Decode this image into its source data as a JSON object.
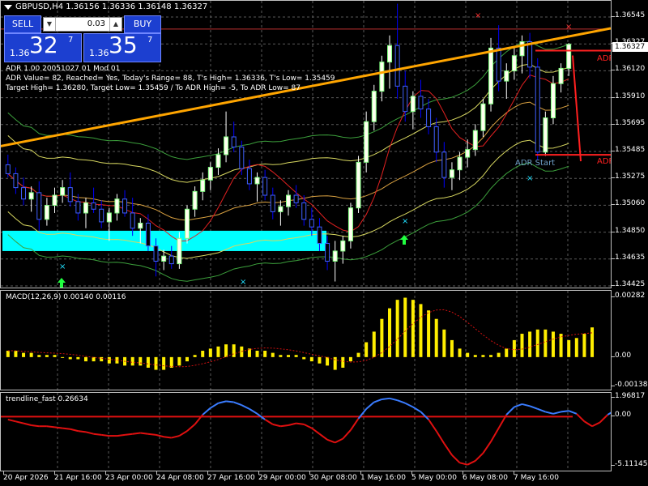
{
  "chart": {
    "title": "GBPUSD,H4  1.36156 1.36336 1.36148 1.36327",
    "current_price": "1.36327"
  },
  "trade_panel": {
    "sell_label": "SELL",
    "buy_label": "BUY",
    "lot": "0.03",
    "sell_small": "1.36",
    "sell_big": "32",
    "sell_sup": "7",
    "buy_small": "1.36",
    "buy_big": "35",
    "buy_sup": "7"
  },
  "adr_info": {
    "line1": "ADR 1.00 20051027 01 Mod 01",
    "line2": "ADR Value= 82, Reached= Yes, Today's Range= 88, T's High= 1.36336, T's Low= 1.35459",
    "line3": "Target High= 1.36280, Target Low= 1.35459 / To ADR High= -5, To ADR Low= 87"
  },
  "adr_labels": {
    "top": "ADR",
    "bottom": "ADR",
    "start": "ADR Start"
  },
  "main_axis": [
    "1.36545",
    "1.36327",
    "1.36120",
    "1.35910",
    "1.35695",
    "1.35485",
    "1.35275",
    "1.35060",
    "1.34850",
    "1.34635",
    "1.34425"
  ],
  "macd": {
    "title": "MACD(12,26,9) 0.00140 0.00116",
    "axis": [
      "0.00282",
      "0.00",
      "-0.00138"
    ]
  },
  "trendline": {
    "title": "trendline_fast 0.26634",
    "axis": [
      "1.96817",
      "0.00",
      "-5.11145"
    ]
  },
  "time_axis": [
    "20 Apr 2026",
    "21 Apr 16:00",
    "23 Apr 00:00",
    "24 Apr 08:00",
    "27 Apr 16:00",
    "29 Apr 00:00",
    "30 Apr 08:00",
    "1 May 16:00",
    "5 May 00:00",
    "6 May 08:00",
    "7 May 16:00"
  ],
  "colors": {
    "bull": "#ffffff",
    "bear": "#0000ff",
    "macd_hist": "#ffee00",
    "signal": "#d01010",
    "tl_pos": "#3a7cff",
    "tl_neg": "#e01010",
    "trend_orange": "#ffa500",
    "zone": "#00ffff"
  },
  "chart_data": {
    "type": "candlestick",
    "symbol": "GBPUSD",
    "timeframe": "H4",
    "ohlc": [
      [
        1.3538,
        1.3546,
        1.3528,
        1.3531
      ],
      [
        1.3531,
        1.3536,
        1.3515,
        1.352
      ],
      [
        1.352,
        1.3528,
        1.3506,
        1.3511
      ],
      [
        1.3511,
        1.3521,
        1.3501,
        1.3516
      ],
      [
        1.3516,
        1.3525,
        1.3486,
        1.3495
      ],
      [
        1.3495,
        1.3512,
        1.349,
        1.3506
      ],
      [
        1.3506,
        1.352,
        1.35,
        1.3514
      ],
      [
        1.3514,
        1.3526,
        1.3508,
        1.352
      ],
      [
        1.352,
        1.3532,
        1.3505,
        1.3509
      ],
      [
        1.3509,
        1.3515,
        1.3494,
        1.35
      ],
      [
        1.35,
        1.3512,
        1.3488,
        1.3508
      ],
      [
        1.3508,
        1.352,
        1.35,
        1.3503
      ],
      [
        1.3503,
        1.351,
        1.3488,
        1.3493
      ],
      [
        1.3493,
        1.3504,
        1.3478,
        1.35
      ],
      [
        1.35,
        1.3515,
        1.3494,
        1.3511
      ],
      [
        1.3511,
        1.3518,
        1.3497,
        1.35
      ],
      [
        1.35,
        1.3512,
        1.3482,
        1.3488
      ],
      [
        1.3488,
        1.3496,
        1.3476,
        1.3492
      ],
      [
        1.3492,
        1.3499,
        1.347,
        1.3474
      ],
      [
        1.3474,
        1.348,
        1.345,
        1.3462
      ],
      [
        1.3462,
        1.3471,
        1.3455,
        1.3466
      ],
      [
        1.3466,
        1.3474,
        1.3456,
        1.346
      ],
      [
        1.346,
        1.3485,
        1.3456,
        1.348
      ],
      [
        1.348,
        1.3506,
        1.3476,
        1.3503
      ],
      [
        1.3503,
        1.3521,
        1.3497,
        1.3517
      ],
      [
        1.3517,
        1.3532,
        1.351,
        1.3526
      ],
      [
        1.3526,
        1.354,
        1.3518,
        1.3536
      ],
      [
        1.3536,
        1.3551,
        1.353,
        1.3546
      ],
      [
        1.3546,
        1.358,
        1.354,
        1.356
      ],
      [
        1.356,
        1.3572,
        1.3548,
        1.3552
      ],
      [
        1.3552,
        1.3557,
        1.353,
        1.3535
      ],
      [
        1.3535,
        1.3542,
        1.3518,
        1.3523
      ],
      [
        1.3523,
        1.3532,
        1.3509,
        1.3528
      ],
      [
        1.3528,
        1.3534,
        1.351,
        1.3514
      ],
      [
        1.3514,
        1.352,
        1.3495,
        1.3501
      ],
      [
        1.3501,
        1.351,
        1.349,
        1.3505
      ],
      [
        1.3505,
        1.3518,
        1.3498,
        1.3514
      ],
      [
        1.3514,
        1.3522,
        1.3504,
        1.3508
      ],
      [
        1.3508,
        1.3514,
        1.349,
        1.3495
      ],
      [
        1.3495,
        1.3504,
        1.3482,
        1.3489
      ],
      [
        1.3489,
        1.3496,
        1.347,
        1.3476
      ],
      [
        1.3476,
        1.3482,
        1.3455,
        1.3462
      ],
      [
        1.3462,
        1.3478,
        1.3446,
        1.347
      ],
      [
        1.347,
        1.3482,
        1.346,
        1.3478
      ],
      [
        1.3478,
        1.3508,
        1.3472,
        1.3504
      ],
      [
        1.3504,
        1.3545,
        1.35,
        1.354
      ],
      [
        1.354,
        1.358,
        1.3532,
        1.3572
      ],
      [
        1.3572,
        1.3601,
        1.3565,
        1.3596
      ],
      [
        1.3596,
        1.3624,
        1.3588,
        1.3619
      ],
      [
        1.3619,
        1.364,
        1.3598,
        1.3632
      ],
      [
        1.3632,
        1.3665,
        1.359,
        1.36
      ],
      [
        1.36,
        1.3612,
        1.3572,
        1.358
      ],
      [
        1.358,
        1.3596,
        1.3566,
        1.3592
      ],
      [
        1.3592,
        1.3605,
        1.3575,
        1.3582
      ],
      [
        1.3582,
        1.359,
        1.3562,
        1.3568
      ],
      [
        1.3568,
        1.3575,
        1.354,
        1.3548
      ],
      [
        1.3548,
        1.3556,
        1.352,
        1.3528
      ],
      [
        1.3528,
        1.354,
        1.3518,
        1.3534
      ],
      [
        1.3534,
        1.3548,
        1.3526,
        1.3544
      ],
      [
        1.3544,
        1.3558,
        1.3536,
        1.355
      ],
      [
        1.355,
        1.357,
        1.3545,
        1.3565
      ],
      [
        1.3565,
        1.359,
        1.356,
        1.3586
      ],
      [
        1.3586,
        1.3638,
        1.358,
        1.363
      ],
      [
        1.363,
        1.3648,
        1.3596,
        1.3604
      ],
      [
        1.3604,
        1.3618,
        1.359,
        1.3612
      ],
      [
        1.3612,
        1.363,
        1.3605,
        1.3624
      ],
      [
        1.3624,
        1.364,
        1.361,
        1.3635
      ],
      [
        1.3635,
        1.3642,
        1.3606,
        1.3615
      ],
      [
        1.3615,
        1.3622,
        1.3542,
        1.3548
      ],
      [
        1.3548,
        1.358,
        1.3545,
        1.3575
      ],
      [
        1.3575,
        1.3608,
        1.357,
        1.3602
      ],
      [
        1.3602,
        1.3618,
        1.3595,
        1.3614
      ],
      [
        1.3614,
        1.3634,
        1.3608,
        1.3633
      ]
    ],
    "trendline_orange": [
      {
        "x": 0,
        "y": 1.3566
      },
      {
        "x": 72,
        "y": 1.3644
      }
    ],
    "adr_high": 1.3628,
    "adr_low": 1.35459,
    "ylim": [
      1.34425,
      1.36545
    ],
    "macd_hist": [
      0.0003,
      0.0003,
      0.0002,
      0.0002,
      0.0001,
      0.0001,
      0.0001,
      0.0,
      -0.0001,
      -0.0001,
      -0.0002,
      -0.0002,
      -0.0002,
      -0.0003,
      -0.0003,
      -0.0004,
      -0.0004,
      -0.0004,
      -0.0005,
      -0.0006,
      -0.0006,
      -0.0005,
      -0.0004,
      -0.0002,
      0.0001,
      0.0003,
      0.0004,
      0.0005,
      0.0006,
      0.0006,
      0.0005,
      0.0004,
      0.0003,
      0.0003,
      0.0002,
      0.0001,
      0.0001,
      0.0001,
      -0.0001,
      -0.0002,
      -0.0003,
      -0.0004,
      -0.0006,
      -0.0005,
      -0.0002,
      0.0002,
      0.0007,
      0.0012,
      0.0018,
      0.0023,
      0.0027,
      0.0028,
      0.0027,
      0.0025,
      0.0022,
      0.0018,
      0.0013,
      0.0008,
      0.0004,
      0.0002,
      0.0001,
      0.0001,
      0.0001,
      0.0002,
      0.0004,
      0.0008,
      0.0011,
      0.0012,
      0.0013,
      0.0013,
      0.0012,
      0.0011,
      0.0008,
      0.0009,
      0.0011,
      0.0014
    ],
    "macd_ylim": [
      -0.00138,
      0.00282
    ],
    "trendline_fast": [
      -0.3,
      -0.5,
      -0.7,
      -0.9,
      -1.0,
      -1.0,
      -1.1,
      -1.2,
      -1.3,
      -1.5,
      -1.6,
      -1.8,
      -1.9,
      -2.0,
      -2.0,
      -1.9,
      -1.8,
      -1.7,
      -1.8,
      -1.9,
      -2.1,
      -2.2,
      -2.0,
      -1.5,
      -0.8,
      0.2,
      0.9,
      1.4,
      1.6,
      1.5,
      1.2,
      0.8,
      0.3,
      -0.3,
      -0.8,
      -1.0,
      -0.9,
      -0.7,
      -0.8,
      -1.2,
      -1.8,
      -2.4,
      -2.7,
      -2.3,
      -1.4,
      -0.2,
      0.8,
      1.5,
      1.8,
      1.9,
      1.7,
      1.4,
      1.0,
      0.5,
      -0.3,
      -1.5,
      -2.8,
      -4.0,
      -4.8,
      -5.0,
      -4.6,
      -3.8,
      -2.6,
      -1.2,
      0.2,
      1.0,
      1.3,
      1.1,
      0.8,
      0.5,
      0.3,
      0.5,
      0.6,
      0.3,
      -0.5,
      -1.0,
      -0.6,
      0.2,
      0.7,
      0.6
    ],
    "trendline_ylim": [
      -5.11145,
      1.96817
    ]
  }
}
